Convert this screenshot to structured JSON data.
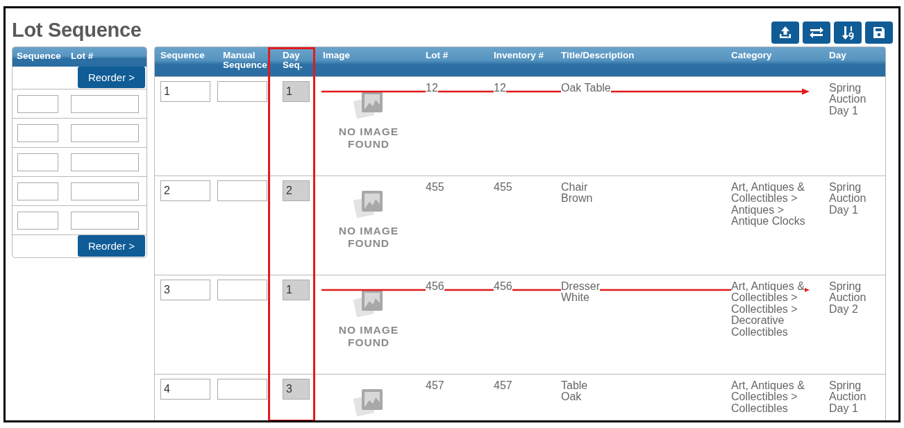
{
  "page": {
    "title": "Lot Sequence"
  },
  "toolbar": [
    {
      "kind": "upload"
    },
    {
      "kind": "swap"
    },
    {
      "kind": "sort"
    },
    {
      "kind": "save"
    }
  ],
  "left_panel": {
    "columns": [
      "Sequence",
      "Lot #"
    ],
    "rows": [
      {
        "kind": "button",
        "label": "Reorder >"
      },
      {
        "kind": "inputs"
      },
      {
        "kind": "inputs"
      },
      {
        "kind": "inputs"
      },
      {
        "kind": "inputs"
      },
      {
        "kind": "inputs"
      },
      {
        "kind": "button",
        "label": "Reorder >"
      }
    ]
  },
  "table": {
    "columns": [
      {
        "label": "Sequence",
        "highlighted": false
      },
      {
        "label": "Manual\nSequence",
        "highlighted": false
      },
      {
        "label": "Day\nSeq.",
        "highlighted": true
      },
      {
        "label": "Image",
        "highlighted": false
      },
      {
        "label": "Lot #",
        "highlighted": false
      },
      {
        "label": "Inventory #",
        "highlighted": false
      },
      {
        "label": "Title/Description",
        "highlighted": false
      },
      {
        "label": "Category",
        "highlighted": false
      },
      {
        "label": "Day",
        "highlighted": false
      }
    ],
    "rows": [
      {
        "sequence": "1",
        "day_seq": "1",
        "day_seq_disabled": true,
        "image_text": "NO IMAGE\nFOUND",
        "lot": "12",
        "inventory": "12",
        "title": "Oak Table",
        "day": "Spring\nAuction\nDay 1",
        "arrow": true
      },
      {
        "sequence": "2",
        "day_seq": "2",
        "day_seq_disabled": true,
        "image_text": "NO IMAGE\nFOUND",
        "lot": "455",
        "inventory": "455",
        "title": "Chair\nBrown",
        "category": "Art, Antiques &\nCollectibles >\nAntiques >\nAntique Clocks",
        "day": "Spring\nAuction\nDay 1",
        "arrow": false
      },
      {
        "sequence": "3",
        "day_seq": "1",
        "day_seq_disabled": true,
        "image_text": "NO IMAGE\nFOUND",
        "lot": "456",
        "inventory": "456",
        "title": "Dresser\nWhite",
        "category": "Art, Antiques &\nCollectibles >\nCollectibles >\nDecorative\nCollectibles",
        "day": "Spring\nAuction\nDay 2",
        "arrow": true
      },
      {
        "sequence": "4",
        "day_seq": "3",
        "day_seq_disabled": true,
        "lot": "457",
        "inventory": "457",
        "title": "Table\nOak",
        "category": "Art, Antiques &\nCollectibles >\nCollectibles",
        "day": "Spring\nAuction\nDay 1",
        "arrow": false
      }
    ]
  }
}
